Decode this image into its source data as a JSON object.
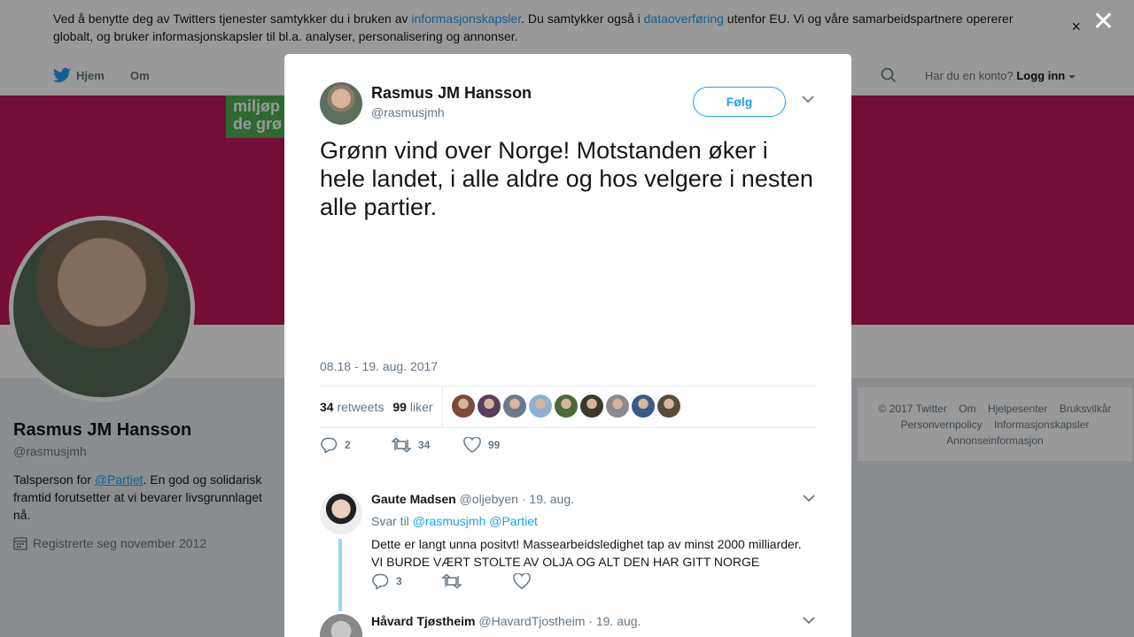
{
  "cookie": {
    "text_1": "Ved å benytte deg av Twitters tjenester samtykker du i bruken av ",
    "link_1": "informasjonskapsler",
    "text_2": ". Du samtykker også i ",
    "link_2": "dataoverføring",
    "text_3": " utenfor EU. Vi og våre samarbeidspartnere opererer globalt, og bruker informasjonskapsler til bl.a. analyser, personalisering og annonser.",
    "close": "×"
  },
  "nav": {
    "home": "Hjem",
    "about": "Om",
    "account_prompt": "Har du en konto?",
    "login": "Logg inn"
  },
  "banner": {
    "logo_text_1": "miljøp",
    "logo_text_2": "de grø"
  },
  "profile": {
    "name": "Rasmus JM Hansson",
    "handle": "@rasmusjmh",
    "bio_1": "Talsperson for ",
    "bio_link": "@Partiet",
    "bio_2": ". En god og solidarisk framtid forutsetter at vi bevarer livsgrunnlaget nå.",
    "joined": "Registrerte seg november 2012"
  },
  "footer": {
    "items": [
      "© 2017 Twitter",
      "Om",
      "Hjelpesenter",
      "Bruksvilkår",
      "Personvernpolicy",
      "Informasjonskapsler",
      "Annonseinformasjon"
    ]
  },
  "overlay": {
    "close": "✕"
  },
  "tweet": {
    "name": "Rasmus JM Hansson",
    "handle": "@rasmusjmh",
    "follow": "Følg",
    "text": "Grønn vind over Norge! Motstanden øker i hele landet, i alle aldre og hos velgere i nesten alle partier.",
    "time": "08.18 - 19. aug. 2017",
    "retweets_count": "34",
    "retweets_label": "retweets",
    "likes_count": "99",
    "likes_label": "liker",
    "liker_colors": [
      "#7b4a3a",
      "#5a3e5e",
      "#6b7a8a",
      "#8fb0d0",
      "#4a6a3a",
      "#3a3a2a",
      "#8a8a8a",
      "#3a5a8a",
      "#5a4a3a"
    ],
    "replies_count": "2",
    "retweet_action_count": "34",
    "like_action_count": "99"
  },
  "replies": [
    {
      "name": "Gaute Madsen",
      "handle": "@oljebyen",
      "date": "· 19. aug.",
      "reply_to_label": "Svar til",
      "reply_to": "@rasmusjmh @Partiet",
      "text": "Dette er langt unna positvt! Massearbeidsledighet tap av minst 2000 milliarder. VI BURDE VÆRT STOLTE AV OLJA OG ALT DEN HAR GITT NORGE",
      "reply_count": "3"
    },
    {
      "name": "Håvard Tjøstheim",
      "handle": "@HavardTjostheim",
      "date": "· 19. aug."
    }
  ]
}
